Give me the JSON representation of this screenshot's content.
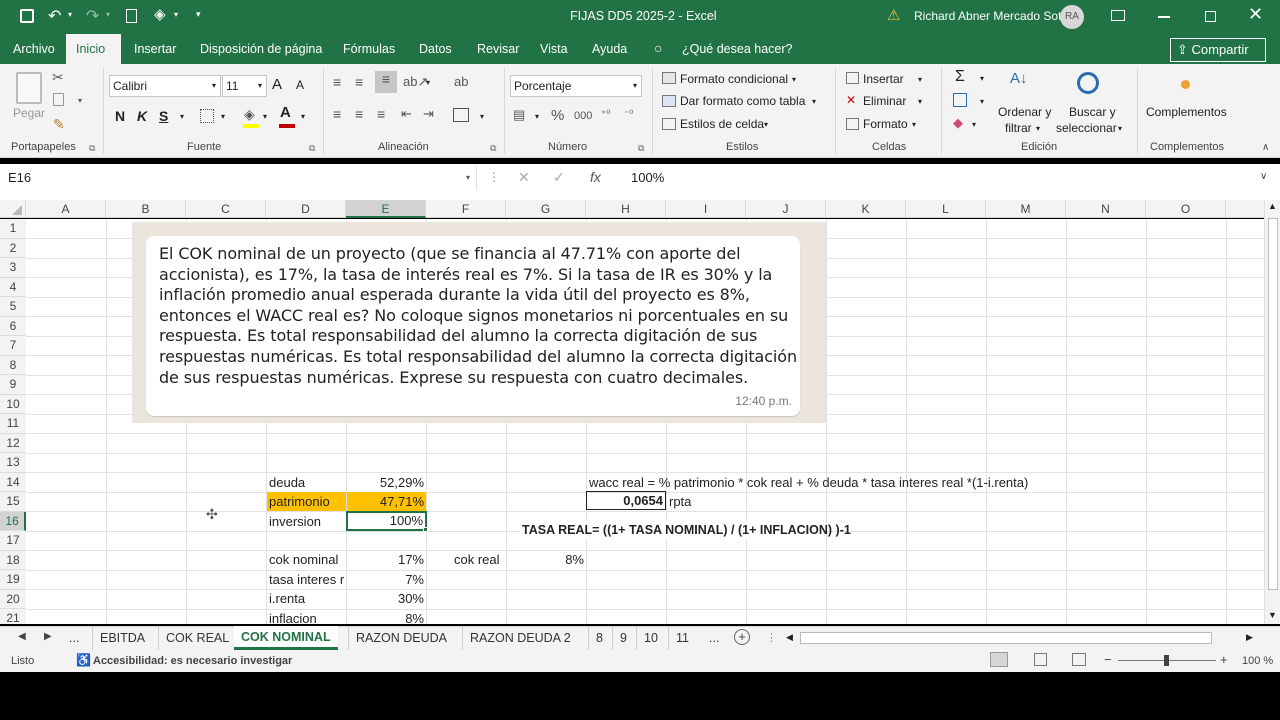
{
  "titlebar": {
    "doc_title": "FIJAS DD5 2025-2  -  Excel",
    "user_name": "Richard Abner Mercado Soto",
    "user_initials": "RA",
    "warning_icon": "warning-icon",
    "accent": "#217346"
  },
  "ribbon_tabs": [
    "Archivo",
    "Inicio",
    "Insertar",
    "Disposición de página",
    "Fórmulas",
    "Datos",
    "Revisar",
    "Vista",
    "Ayuda",
    "¿Qué desea hacer?"
  ],
  "share_button": "Compartir",
  "ribbon": {
    "paste": "Pegar",
    "font_name": "Calibri",
    "font_size": "11",
    "bold": "N",
    "italic": "K",
    "underline": "S",
    "number_format": "Porcentaje",
    "percent": "%",
    "thousands": "000",
    "cond_format": "Formato condicional",
    "format_table": "Dar formato como tabla",
    "cell_styles": "Estilos de celda",
    "insert": "Insertar",
    "delete": "Eliminar",
    "format": "Formato",
    "sort_filter_1": "Ordenar y",
    "sort_filter_2": "filtrar",
    "find_select_1": "Buscar y",
    "find_select_2": "seleccionar",
    "addins": "Complementos",
    "groups": [
      "Portapapeles",
      "Fuente",
      "Alineación",
      "Número",
      "Estilos",
      "Celdas",
      "Edición",
      "Complementos"
    ]
  },
  "formula_bar": {
    "name_box": "E16",
    "fx": "fx",
    "value": "100%"
  },
  "columns": [
    "A",
    "B",
    "C",
    "D",
    "E",
    "F",
    "G",
    "H",
    "I",
    "J",
    "K",
    "L",
    "M",
    "N",
    "O"
  ],
  "rows": [
    "1",
    "2",
    "3",
    "4",
    "5",
    "6",
    "7",
    "8",
    "9",
    "10",
    "11",
    "12",
    "13",
    "14",
    "15",
    "16",
    "17",
    "18",
    "19",
    "20",
    "21"
  ],
  "cells": {
    "d14": "deuda",
    "e14": "52,29%",
    "d15": "patrimonio",
    "e15": "47,71%",
    "d16": "inversion",
    "e16": "100%",
    "d18": "cok nominal",
    "e18": "17%",
    "f18": "cok real",
    "g18": "8%",
    "d19": "tasa interes r",
    "e19": "7%",
    "d20": "i.renta",
    "e20": "30%",
    "d21": "inflacion",
    "e21": "8%",
    "h14": "wacc real = % patrimonio * cok real + % deuda * tasa interes real *(1-i.renta)",
    "h15": "0,0654",
    "i15": "rpta",
    "g16_formula": "TASA REAL= ((1+ TASA NOMINAL) / (1+ INFLACION) )-1",
    "highlight": "#ffc000"
  },
  "bubble": {
    "text": "El COK nominal de un proyecto (que se financia al 47.71% con aporte del accionista), es 17%, la tasa de interés real es 7%. Si la tasa de IR es 30% y la inflación promedio anual esperada durante la vida útil del proyecto es 8%, entonces el WACC real es? No coloque signos monetarios ni porcentuales en su respuesta. Es total responsabilidad del alumno la correcta digitación de sus respuestas numéricas. Es total responsabilidad del alumno la correcta digitación de sus respuestas numéricas. Exprese su respuesta con cuatro decimales.",
    "time": "12:40 p.m."
  },
  "sheets": [
    "...",
    "EBITDA",
    "COK REAL",
    "COK NOMINAL",
    "RAZON DEUDA",
    "RAZON DEUDA 2",
    "8",
    "9",
    "10",
    "11",
    "..."
  ],
  "active_sheet": "COK NOMINAL",
  "status": {
    "ready": "Listo",
    "accessibility": "Accesibilidad: es necesario investigar",
    "zoom": "100 %"
  }
}
